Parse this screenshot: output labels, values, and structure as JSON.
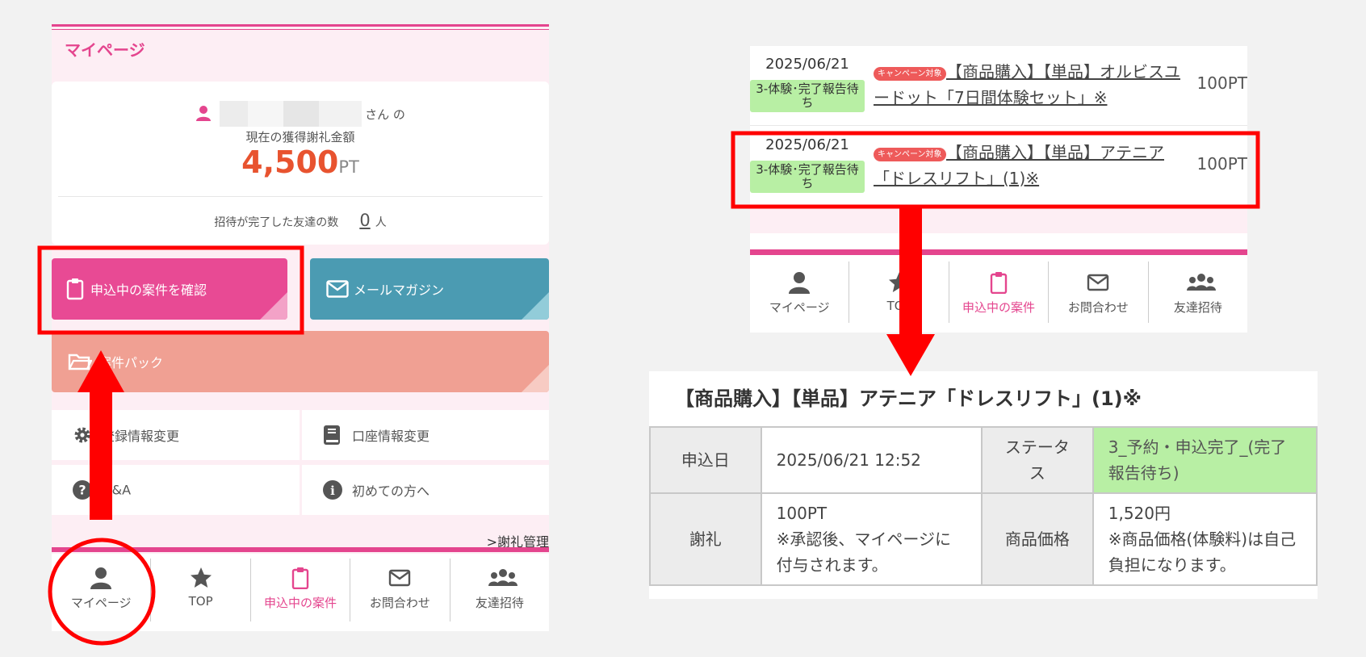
{
  "left_panel": {
    "title": "マイページ",
    "user_suffix": "さん の",
    "earned_label": "現在の獲得謝礼金額",
    "points_value": "4,500",
    "points_unit": "PT",
    "friends_label": "招待が完了した友達の数",
    "friends_count": "0",
    "friends_unit": "人",
    "tiles": {
      "apply": "申込中の案件を確認",
      "mail": "メールマガジン",
      "pack": "案件パック"
    },
    "menu": {
      "register": "登録情報変更",
      "account": "口座情報変更",
      "qa": "Q&A",
      "first": "初めての方へ"
    },
    "reward_link": ">謝礼管理"
  },
  "bottom_nav": {
    "mypage": "マイページ",
    "top": "TOP",
    "applying": "申込中の案件",
    "contact": "お問合わせ",
    "invite": "友達招待"
  },
  "applications": [
    {
      "date": "2025/06/21",
      "status": "3-体験･完了報告待ち",
      "badge": "キャンペーン対象",
      "title": "【商品購入】【単品】オルビスユードット「7日間体験セット」※",
      "points": "100PT"
    },
    {
      "date": "2025/06/21",
      "status": "3-体験･完了報告待ち",
      "badge": "キャンペーン対象",
      "title": "【商品購入】【単品】アテニア「ドレスリフト」(1)※",
      "points": "100PT"
    }
  ],
  "detail": {
    "title": "【商品購入】【単品】アテニア「ドレスリフト」(1)※",
    "apply_date_label": "申込日",
    "apply_date": "2025/06/21 12:52",
    "status_label": "ステータス",
    "status": "3_予約・申込完了_(完了報告待ち)",
    "reward_label": "謝礼",
    "reward_value": "100PT",
    "reward_note": "※承認後、マイページに付与されます。",
    "price_label": "商品価格",
    "price_value": "1,520円",
    "price_note": "※商品価格(体験料)は自己負担になります。"
  },
  "colors": {
    "pink": "#e4458e",
    "points": "#e8532f",
    "status_green": "#b8efa4",
    "annotation_red": "#ff0000"
  }
}
